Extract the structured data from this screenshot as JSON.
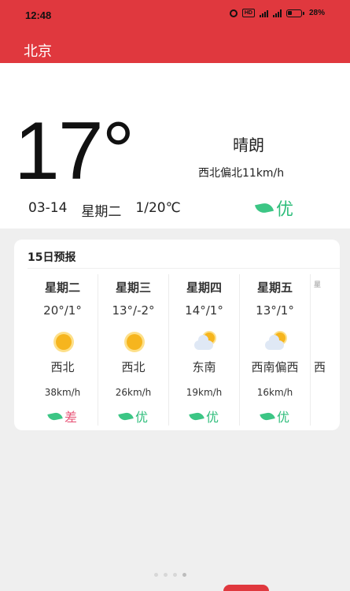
{
  "status_bar": {
    "time": "12:48",
    "hd_label": "HD",
    "battery": "28%"
  },
  "app": {
    "city": "北京"
  },
  "current": {
    "temperature": "17°",
    "condition": "晴朗",
    "wind": "西北偏北11km/h",
    "date": "03-14",
    "weekday": "星期二",
    "range": "1/20℃",
    "aqi": "优"
  },
  "forecast": {
    "title": "15日预报",
    "days": [
      {
        "weekday": "星期二",
        "range": "20°/1°",
        "icon": "sunny-icon",
        "direction": "西北",
        "speed": "38km/h",
        "aqi": "差",
        "aqi_color": "#e8587a"
      },
      {
        "weekday": "星期三",
        "range": "13°/-2°",
        "icon": "sunny-icon",
        "direction": "西北",
        "speed": "26km/h",
        "aqi": "优",
        "aqi_color": "#2dbd7a"
      },
      {
        "weekday": "星期四",
        "range": "14°/1°",
        "icon": "partly-cloudy-icon",
        "direction": "东南",
        "speed": "19km/h",
        "aqi": "优",
        "aqi_color": "#2dbd7a"
      },
      {
        "weekday": "星期五",
        "range": "13°/1°",
        "icon": "partly-cloudy-icon",
        "direction": "西南偏西",
        "speed": "16km/h",
        "aqi": "优",
        "aqi_color": "#2dbd7a"
      },
      {
        "weekday": "星",
        "range": "",
        "icon": "",
        "direction": "西",
        "speed": "",
        "aqi": "",
        "aqi_color": "#2dbd7a"
      }
    ]
  },
  "colors": {
    "accent": "#e0383e",
    "good": "#2dbd7a",
    "bad": "#e8587a"
  }
}
